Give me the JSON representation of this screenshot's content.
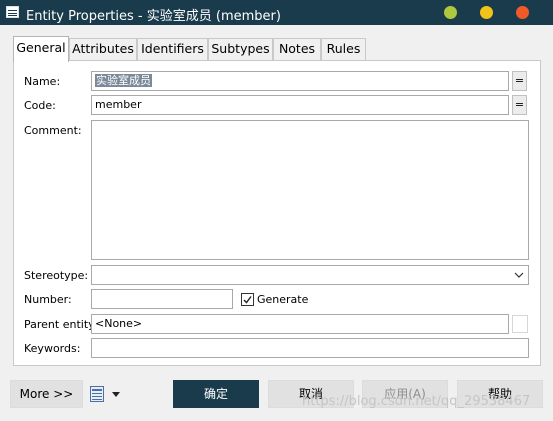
{
  "window": {
    "title": "Entity Properties - 实验室成员 (member)",
    "controls": {
      "minimize_color": "#aec93c",
      "maximize_color": "#f0c419",
      "close_color": "#f05a28"
    }
  },
  "tabs": [
    {
      "label": "General",
      "active": true
    },
    {
      "label": "Attributes"
    },
    {
      "label": "Identifiers"
    },
    {
      "label": "Subtypes"
    },
    {
      "label": "Notes"
    },
    {
      "label": "Rules"
    }
  ],
  "form": {
    "name": {
      "label": "Name:",
      "value": "实验室成员",
      "button": "="
    },
    "code": {
      "label": "Code:",
      "value": "member",
      "button": "="
    },
    "comment": {
      "label": "Comment:",
      "value": ""
    },
    "stereotype": {
      "label": "Stereotype:",
      "value": ""
    },
    "number": {
      "label": "Number:",
      "value": ""
    },
    "generate": {
      "label": "Generate",
      "checked": true
    },
    "parent_entity": {
      "label": "Parent entity:",
      "value": "<None>"
    },
    "keywords": {
      "label": "Keywords:",
      "value": ""
    }
  },
  "footer": {
    "more_label": "More >>",
    "ok_label": "确定",
    "cancel_label": "取消",
    "apply_label": "应用(A)",
    "help_label": "帮助"
  },
  "watermark": "https://blog.csdn.net/qq_29538467"
}
